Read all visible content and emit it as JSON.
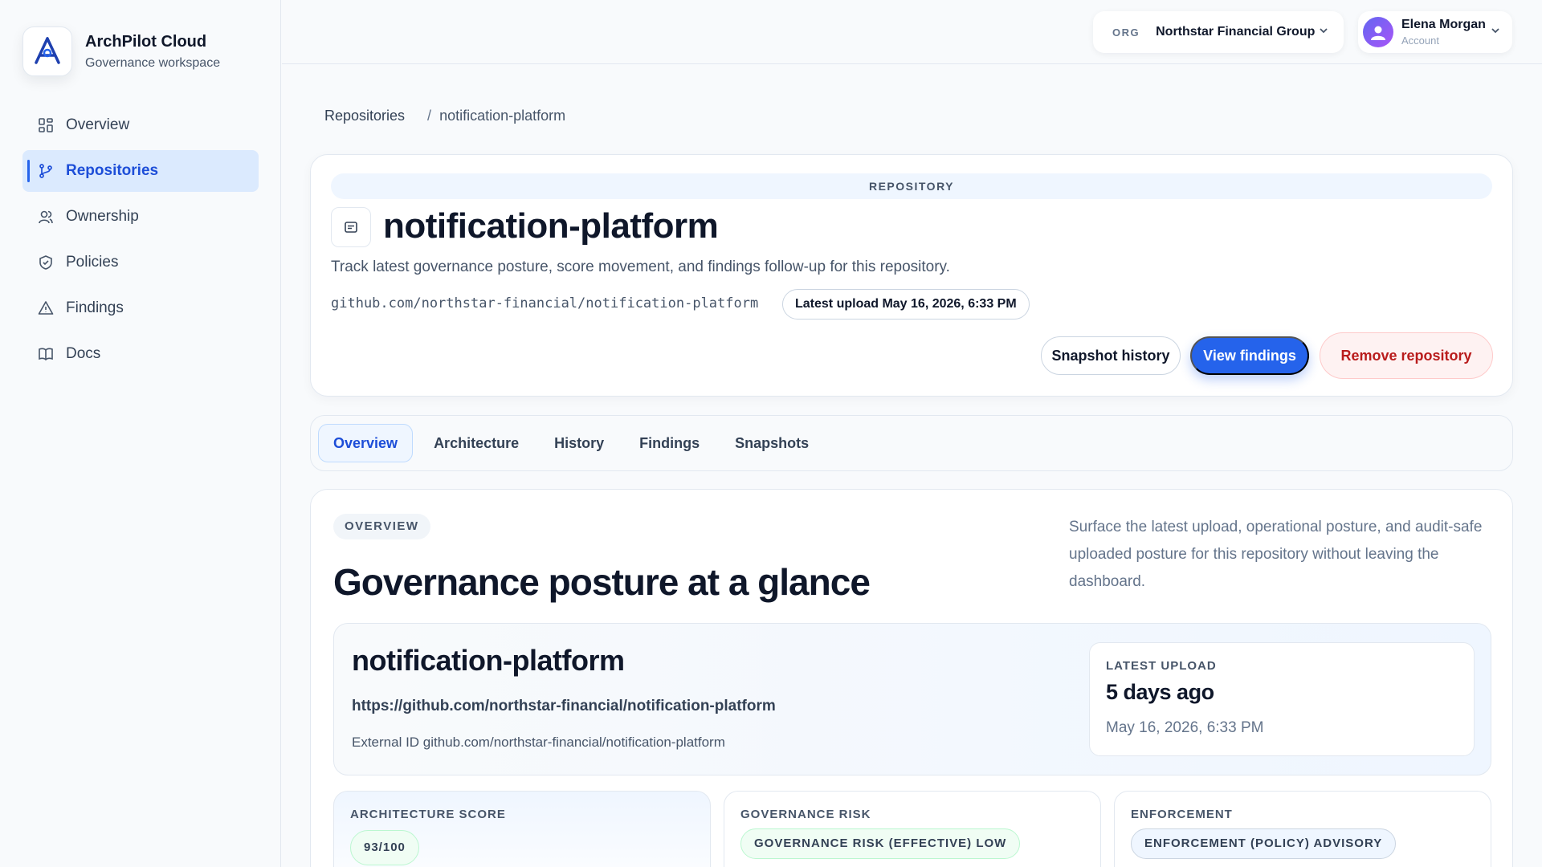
{
  "brand": {
    "name": "ArchPilot Cloud",
    "subtitle": "Governance workspace"
  },
  "nav": {
    "items": [
      {
        "label": "Overview",
        "icon": "grid-icon"
      },
      {
        "label": "Repositories",
        "icon": "git-branch-icon",
        "active": true
      },
      {
        "label": "Ownership",
        "icon": "users-icon"
      },
      {
        "label": "Policies",
        "icon": "shield-icon"
      },
      {
        "label": "Findings",
        "icon": "warning-icon"
      },
      {
        "label": "Docs",
        "icon": "book-icon"
      }
    ]
  },
  "topbar": {
    "org_tag": "ORG",
    "org_name": "Northstar Financial Group",
    "user_name": "Elena Morgan",
    "user_sub": "Account"
  },
  "breadcrumb": {
    "root": "Repositories",
    "separator": "/",
    "current": "notification-platform"
  },
  "repo": {
    "kicker": "REPOSITORY",
    "title": "notification-platform",
    "description": "Track latest governance posture, score movement, and findings follow-up for this repository.",
    "path": "github.com/northstar-financial/notification-platform",
    "upload_chip": "Latest upload May 16, 2026, 6:33 PM",
    "buttons": {
      "history": "Snapshot history",
      "findings": "View findings",
      "remove": "Remove repository"
    }
  },
  "tabs": [
    {
      "label": "Overview",
      "active": true
    },
    {
      "label": "Architecture"
    },
    {
      "label": "History"
    },
    {
      "label": "Findings"
    },
    {
      "label": "Snapshots"
    }
  ],
  "overview": {
    "chip": "OVERVIEW",
    "title": "Governance posture at a glance",
    "description": "Surface the latest upload, operational posture, and audit-safe uploaded posture for this repository without leaving the dashboard.",
    "detail": {
      "name": "notification-platform",
      "url": "https://github.com/northstar-financial/notification-platform",
      "external_id": "External ID github.com/northstar-financial/notification-platform"
    },
    "latest_upload": {
      "label": "LATEST UPLOAD",
      "relative": "5 days ago",
      "date": "May 16, 2026, 6:33 PM"
    },
    "metrics": [
      {
        "label": "ARCHITECTURE SCORE",
        "value": "93/100"
      },
      {
        "label": "GOVERNANCE RISK",
        "value": "GOVERNANCE RISK (EFFECTIVE) LOW"
      },
      {
        "label": "ENFORCEMENT",
        "value": "ENFORCEMENT (POLICY) ADVISORY"
      }
    ]
  },
  "colors": {
    "accent": "#2563eb",
    "danger": "#b91c1c",
    "success_bg": "#f0fdf4"
  }
}
